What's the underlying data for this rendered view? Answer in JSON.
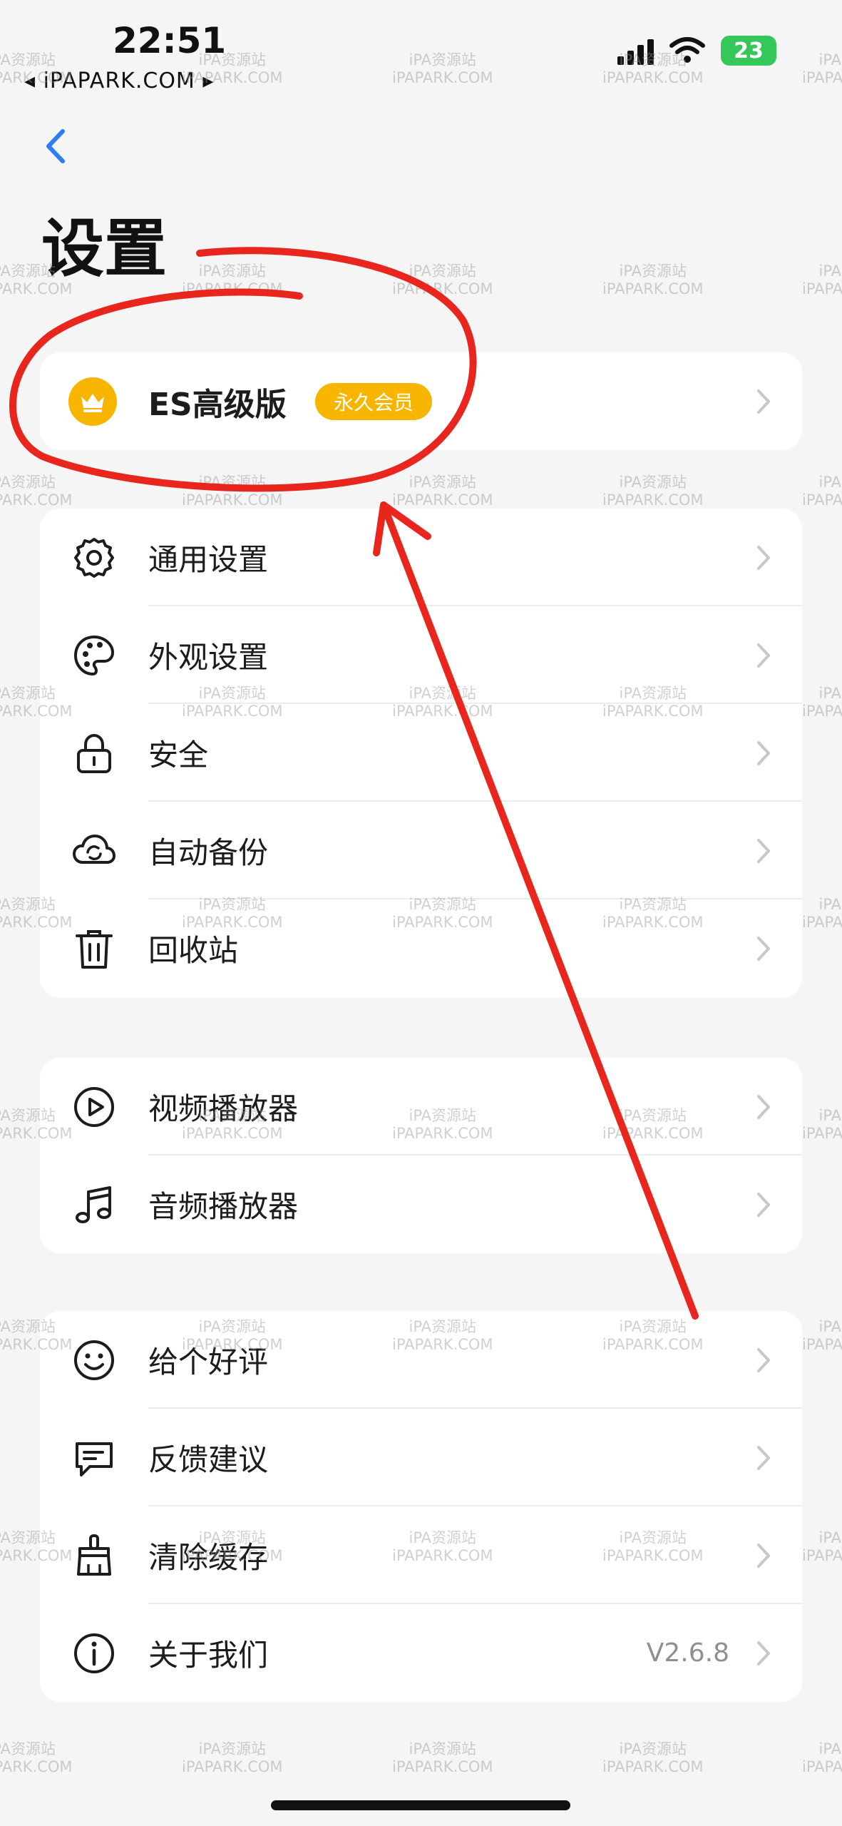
{
  "status_bar": {
    "time": "22:51",
    "back_app": "◂ iPAPARK.COM ▸",
    "battery": "23"
  },
  "header": {
    "back_icon": "chevron-left-icon",
    "title": "设置"
  },
  "premium": {
    "icon": "crown-icon",
    "label": "ES高级版",
    "badge": "永久会员",
    "accent": "#f7b500"
  },
  "sections": [
    {
      "items": [
        {
          "icon": "gear-icon",
          "label": "通用设置"
        },
        {
          "icon": "palette-icon",
          "label": "外观设置"
        },
        {
          "icon": "lock-icon",
          "label": "安全"
        },
        {
          "icon": "cloud-sync-icon",
          "label": "自动备份"
        },
        {
          "icon": "trash-icon",
          "label": "回收站"
        }
      ]
    },
    {
      "items": [
        {
          "icon": "play-circle-icon",
          "label": "视频播放器"
        },
        {
          "icon": "music-note-icon",
          "label": "音频播放器"
        }
      ]
    },
    {
      "items": [
        {
          "icon": "smiley-icon",
          "label": "给个好评"
        },
        {
          "icon": "chat-bubble-icon",
          "label": "反馈建议"
        },
        {
          "icon": "broom-icon",
          "label": "清除缓存"
        },
        {
          "icon": "info-icon",
          "label": "关于我们",
          "value": "V2.6.8"
        }
      ]
    }
  ],
  "watermark": {
    "line1": "iPA资源站",
    "line2": "iPAPARK.COM"
  },
  "annotation_color": "#e8261e"
}
